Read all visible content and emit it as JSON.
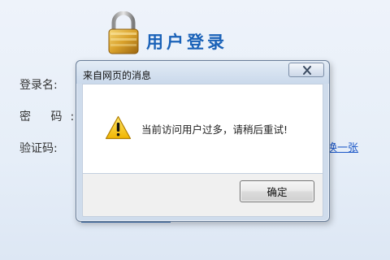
{
  "login": {
    "title": "用户登录",
    "username_label": "登录名:",
    "password_label": "密  码:",
    "captcha_label": "验证码:",
    "refresh_captcha": "换一张"
  },
  "dialog": {
    "title": "来自网页的消息",
    "message": "当前访问用户过多，请稍后重试!",
    "ok_label": "确定",
    "icon": "warning-icon"
  },
  "colors": {
    "login_title": "#1a62b8",
    "link": "#1a56c7",
    "warning": "#f5c400"
  }
}
